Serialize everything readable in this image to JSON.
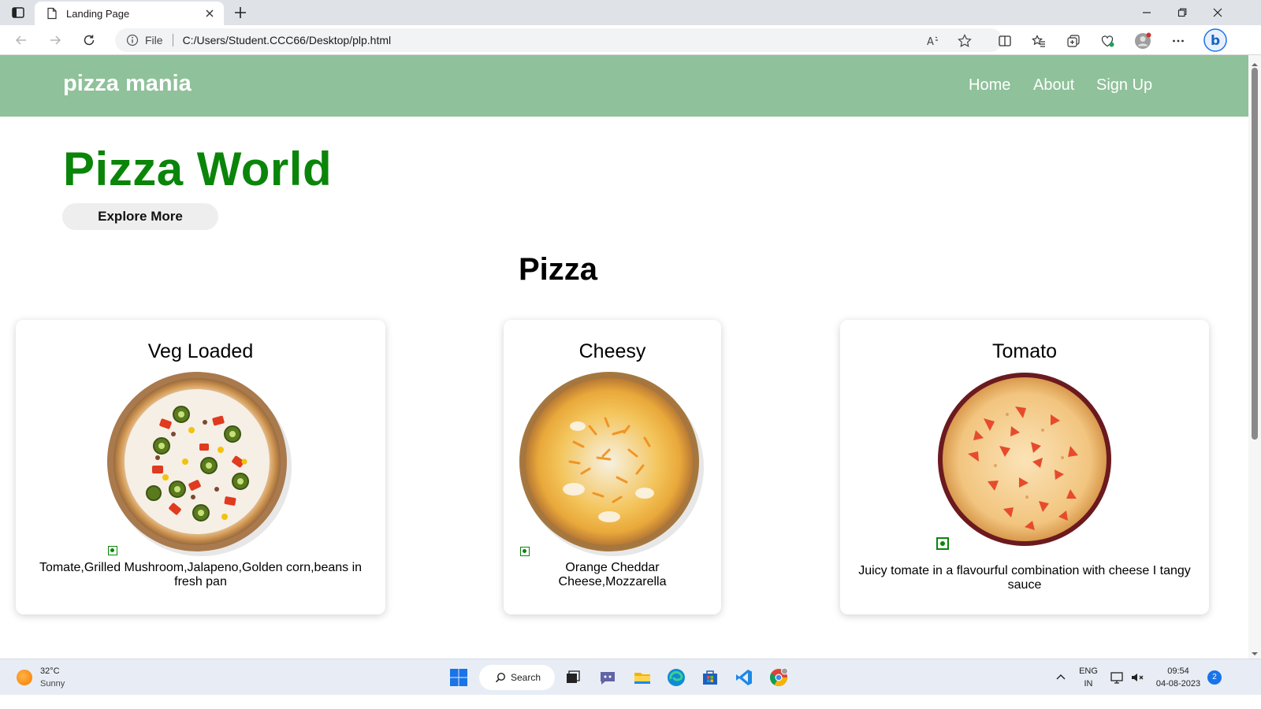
{
  "browser": {
    "tab_title": "Landing Page",
    "file_label": "File",
    "url": "C:/Users/Student.CCC66/Desktop/plp.html"
  },
  "site": {
    "brand": "pizza mania",
    "nav": [
      "Home",
      "About",
      "Sign Up"
    ],
    "hero_title": "Pizza World",
    "explore_label": "Explore More",
    "section_title": "Pizza",
    "cards": [
      {
        "title": "Veg Loaded",
        "desc": "Tomate,Grilled Mushroom,Jalapeno,Golden corn,beans in fresh pan",
        "veg": true
      },
      {
        "title": "Cheesy",
        "desc": "Orange Cheddar Cheese,Mozzarella",
        "veg": true
      },
      {
        "title": "Tomato",
        "desc": "Juicy tomate in a flavourful combination with cheese I tangy sauce",
        "veg": true
      }
    ],
    "colors": {
      "nav_bg": "#8fc19a",
      "hero_green": "#0a850a"
    }
  },
  "taskbar": {
    "temp": "32°C",
    "weather": "Sunny",
    "search_label": "Search",
    "lang": "ENG",
    "region": "IN",
    "time": "09:54",
    "date": "04-08-2023",
    "notifications": "2"
  }
}
